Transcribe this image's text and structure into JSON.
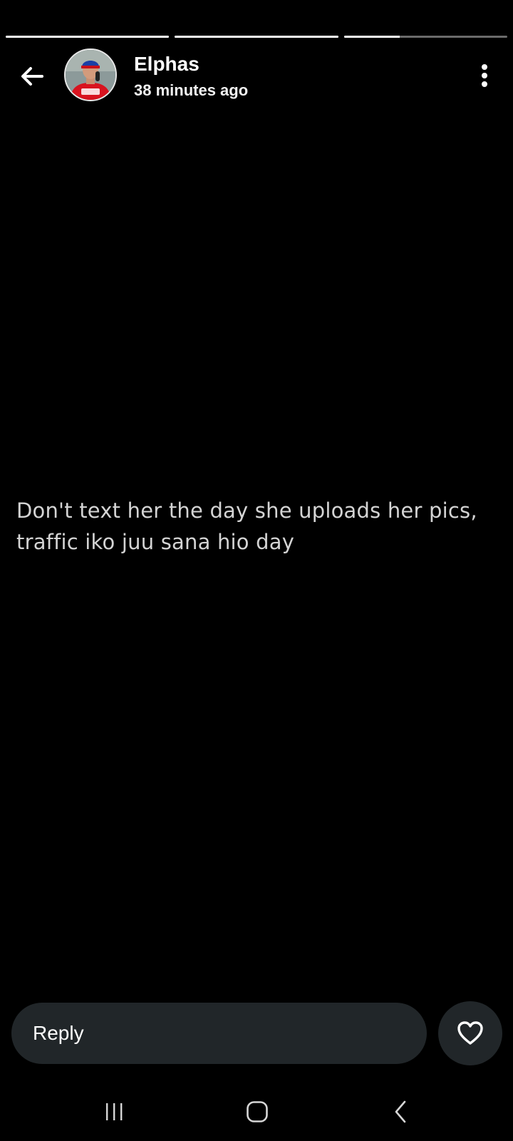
{
  "story": {
    "segments": [
      {
        "progress": 1.0
      },
      {
        "progress": 1.0
      },
      {
        "progress": 0.34
      }
    ],
    "author_name": "Elphas",
    "timestamp": "38 minutes ago",
    "text": "Don't text her the day she uploads her pics, traffic iko juu sana hio day"
  },
  "header": {
    "back_icon": "arrow-left-icon",
    "more_icon": "more-vertical-icon"
  },
  "reply": {
    "placeholder": "Reply",
    "like_icon": "heart-outline-icon"
  },
  "nav": {
    "recents_icon": "recent-apps-icon",
    "home_icon": "home-icon",
    "back_icon": "chevron-left-icon"
  },
  "colors": {
    "background": "#000000",
    "input_bg": "#212629",
    "text": "#ffffff",
    "story_text": "#d4d4d4",
    "progress_track": "#6b6b6b",
    "progress_fill": "#ffffff"
  }
}
